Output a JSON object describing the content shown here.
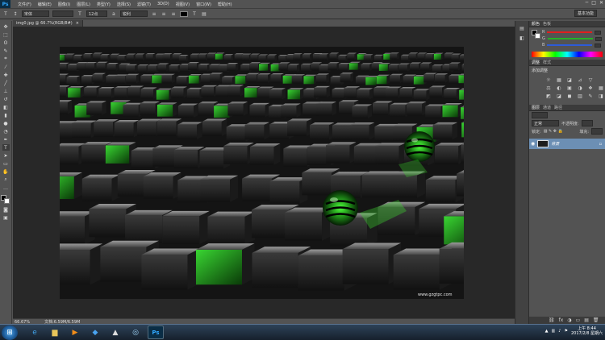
{
  "menubar": {
    "logo": "Ps",
    "items": [
      "文件(F)",
      "编辑(E)",
      "图像(I)",
      "图层(L)",
      "类型(Y)",
      "选择(S)",
      "滤镜(T)",
      "3D(D)",
      "视图(V)",
      "窗口(W)",
      "帮助(H)"
    ],
    "window_controls": [
      "─",
      "□",
      "✕"
    ]
  },
  "options": {
    "font_family": "宋体",
    "font_style": "",
    "font_size": "12点",
    "antialias": "锐利",
    "workspace": "基本功能"
  },
  "document": {
    "tab_title": "img0.jpg @ 66.7%(RGB/8#)",
    "close": "×",
    "zoom": "66.67%",
    "doc_size": "文档:6.59M/6.59M",
    "watermark": "www.gzgtpc.com"
  },
  "panels": {
    "color_tabs": [
      "颜色",
      "色板"
    ],
    "channels": [
      {
        "label": "R",
        "color": "#e01f1f"
      },
      {
        "label": "G",
        "color": "#25b125"
      },
      {
        "label": "B",
        "color": "#2d5bd8"
      }
    ],
    "adjust_tabs": [
      "调整",
      "样式"
    ],
    "adjust_title": "添加调整",
    "adjust_icons": [
      "☼",
      "▦",
      "◪",
      "⊿",
      "▽",
      "",
      "⚖",
      "◐",
      "▣",
      "◑",
      "❖",
      "▦",
      "◩",
      "◪",
      "◼",
      "▥",
      "✎",
      "◨"
    ],
    "layers_tabs": [
      "图层",
      "通道",
      "路径"
    ],
    "blend_mode": "正常",
    "opacity_label": "不透明度:",
    "lock_label": "锁定:",
    "fill_label": "填充:",
    "layer_name": "背景",
    "footer_icons": [
      "⛓",
      "fx",
      "◑",
      "▭",
      "▤",
      "🗑"
    ]
  },
  "taskbar": {
    "start": "⊞",
    "apps": [
      {
        "name": "ie",
        "glyph": "e",
        "color": "#3fa2e8"
      },
      {
        "name": "explorer",
        "glyph": "▆",
        "color": "#e8c55a"
      },
      {
        "name": "media",
        "glyph": "▶",
        "color": "#f08c1a"
      },
      {
        "name": "app-blue",
        "glyph": "◆",
        "color": "#4aa3ef"
      },
      {
        "name": "app-cat",
        "glyph": "▲",
        "color": "#dddddd"
      },
      {
        "name": "app-globe",
        "glyph": "◎",
        "color": "#9fd3f5"
      },
      {
        "name": "photoshop",
        "glyph": "Ps",
        "color": "#31a8ff"
      }
    ],
    "time": "上午 8:44",
    "date": "2017/2/8 星期六"
  }
}
